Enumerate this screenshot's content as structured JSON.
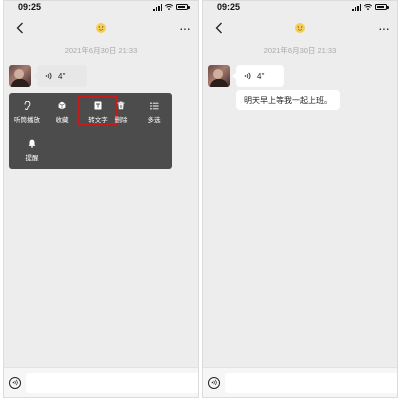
{
  "status_bar": {
    "time": "09:25"
  },
  "chat": {
    "timestamp": "2021年6月30日 21:33",
    "voice_duration": "4''",
    "transcript": "明天早上等我一起上班。"
  },
  "context_menu": {
    "items": [
      {
        "label": "听筒播放",
        "icon": "ear-icon"
      },
      {
        "label": "收藏",
        "icon": "cube-icon"
      },
      {
        "label": "转文字",
        "icon": "text-convert-icon",
        "highlighted": true
      },
      {
        "label": "删除",
        "icon": "trash-icon"
      },
      {
        "label": "多选",
        "icon": "list-icon"
      },
      {
        "label": "提醒",
        "icon": "bell-icon"
      }
    ]
  },
  "colors": {
    "menu_bg": "#4c4c4c",
    "highlight": "#c61b1b",
    "chat_bg": "#ededed"
  }
}
